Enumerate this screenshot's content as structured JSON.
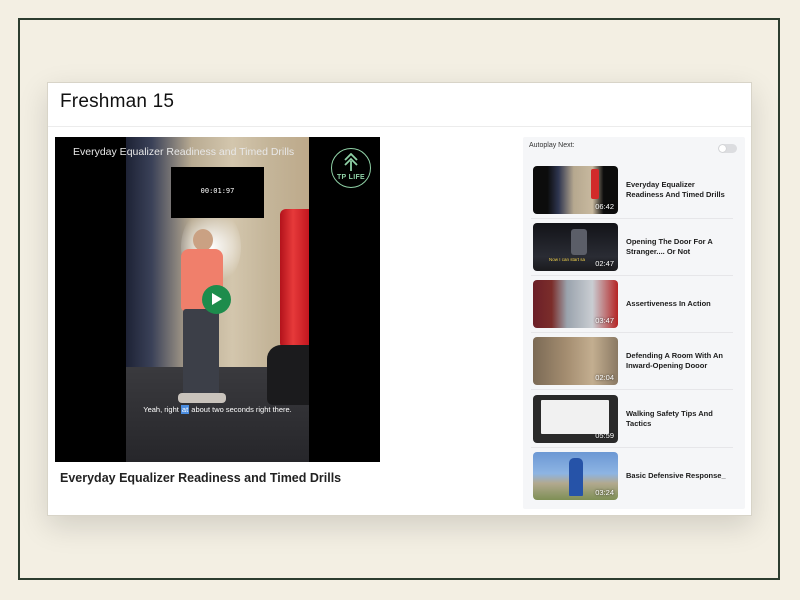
{
  "page": {
    "title": "Freshman 15"
  },
  "player": {
    "video_title": "Everyday Equalizer Readiness and Timed Drills",
    "timer": "00:01:97",
    "logo_text": "TP LIFE",
    "caption_before": "Yeah, right ",
    "caption_highlight": "at",
    "caption_after": " about two seconds right there.",
    "play_icon": "play-icon",
    "accent_color": "#1d8c4c"
  },
  "now_playing": {
    "title": "Everyday Equalizer Readiness and Timed Drills"
  },
  "sidebar": {
    "autoplay_label": "Autoplay Next:",
    "autoplay_on": false,
    "items": [
      {
        "title": "Everyday Equalizer Readiness And Timed Drills",
        "duration": "06:42"
      },
      {
        "title": "Opening The Door For A Stranger.... Or Not",
        "duration": "02:47",
        "thumb_caption": "Now I can start sa"
      },
      {
        "title": "Assertiveness In Action",
        "duration": "03:47"
      },
      {
        "title": "Defending A Room With An Inward-Opening Dooor",
        "duration": "02:04"
      },
      {
        "title": "Walking Safety Tips And Tactics",
        "duration": "05:59"
      },
      {
        "title": "Basic Defensive Response_",
        "duration": "03:24"
      }
    ]
  }
}
